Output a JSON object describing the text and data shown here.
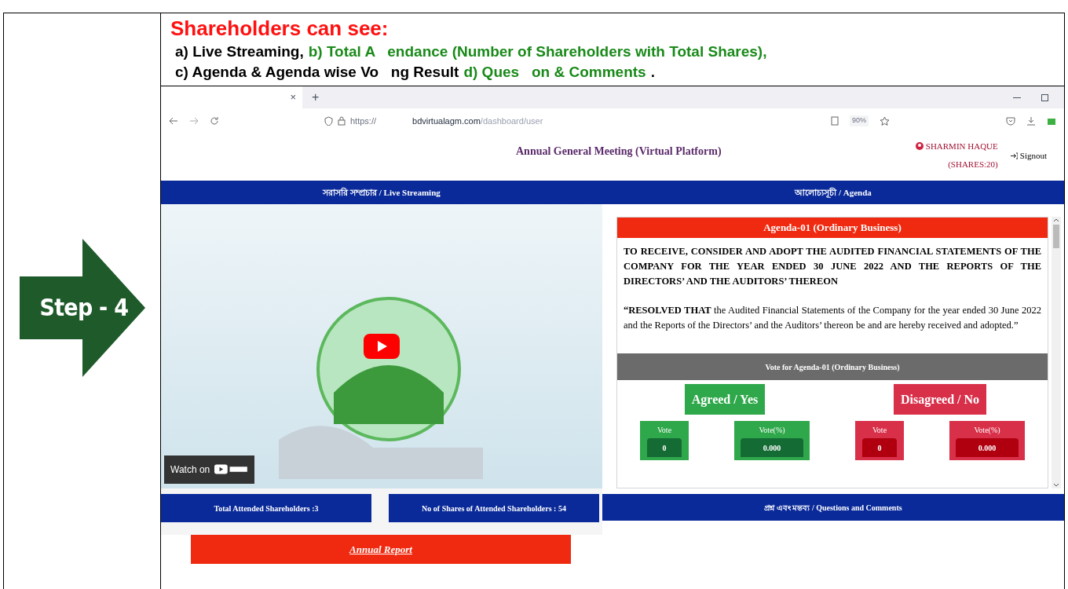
{
  "step": {
    "label": "Step - 4"
  },
  "intro": {
    "title": "Shareholders can see:",
    "lines": [
      [
        {
          "kind": "plain",
          "text": "a) Live Streaming,"
        },
        {
          "kind": "highlight",
          "text": "b) Total A   endance (Number of Shareholders with Total Shares),"
        }
      ],
      [
        {
          "kind": "plain",
          "text": "c) Agenda & Agenda wise Vo   ng Result"
        },
        {
          "kind": "highlight",
          "text": "d) Ques   on & Comments"
        },
        {
          "kind": "plain",
          "text": "."
        }
      ]
    ]
  },
  "browser": {
    "tab_close": "×",
    "new_tab": "+",
    "url_prefix": "https://",
    "url_domain": "bdvirtualagm.com",
    "url_path": "/dashboard/user",
    "zoom": "90%"
  },
  "header": {
    "title": "Annual General Meeting (Virtual Platform)",
    "user": "SHARMIN HAQUE",
    "shares": "(SHARES:20)",
    "signout": "Signout"
  },
  "live": {
    "heading": "সরাসরি সম্প্রচার / Live Streaming",
    "watch_on": "Watch on"
  },
  "agenda": {
    "heading": "আলোচ্যসূচী / Agenda",
    "title": "Agenda-01 (Ordinary Business)",
    "statement": "TO RECEIVE, CONSIDER AND ADOPT THE AUDITED FINANCIAL STATEMENTS OF THE COMPANY FOR THE YEAR ENDED 30 JUNE 2022 AND THE REPORTS OF THE DIRECTORS’ AND THE AUDITORS’ THEREON",
    "resolution": "**“RESOLVED THAT** the Audited Financial Statements of the Company for the year ended 30 June 2022 and the Reports of the Directors’ and the Auditors’ thereon be and are hereby received and adopted.”",
    "vote_title": "Vote for Agenda-01 (Ordinary Business)",
    "options": [
      {
        "kind": "agree",
        "label": "Agreed / Yes",
        "vote_label": "Vote",
        "vote": "0",
        "pct_label": "Vote(%)",
        "pct": "0.000"
      },
      {
        "kind": "disagree",
        "label": "Disagreed / No",
        "vote_label": "Vote",
        "vote": "0",
        "pct_label": "Vote(%)",
        "pct": "0.000"
      }
    ]
  },
  "stats": [
    {
      "text": "Total Attended Shareholders :3"
    },
    {
      "text": "No of Shares of Attended Shareholders : 54"
    }
  ],
  "questions": {
    "heading": "প্রশ্ন এবং মন্তব্য / Questions and Comments"
  },
  "annual_report": {
    "label": "Annual Report"
  }
}
